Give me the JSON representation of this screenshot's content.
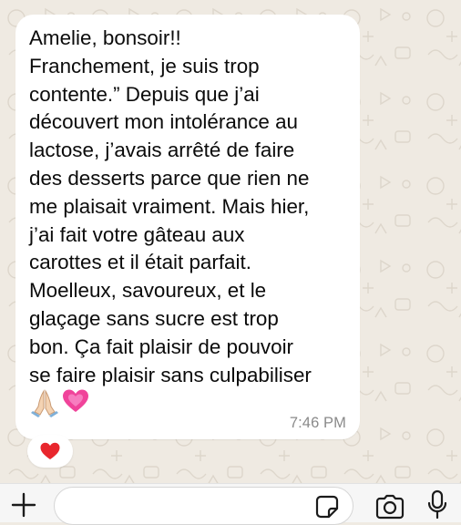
{
  "message": {
    "text": "Amelie, bonsoir!!\nFranchement, je suis trop\ncontente.” Depuis que j’ai\ndécouvert mon intolérance au\nlactose, j’avais arrêté de faire\ndes desserts parce que rien ne\nme plaisait vraiment. Mais hier,\nj’ai fait votre gâteau aux\ncarottes et il était parfait.\nMoelleux, savoureux, et le\nglaçage sans sucre est trop\nbon. Ça fait plaisir de pouvoir\nse faire plaisir sans culpabiliser",
    "emojis": [
      "praying-hands",
      "growing-heart"
    ],
    "time": "7:46 PM",
    "reaction": "red-heart"
  },
  "input": {
    "value": "",
    "placeholder": ""
  },
  "icons": {
    "attach": "plus-icon",
    "sticker": "sticker-icon",
    "camera": "camera-icon",
    "microphone": "microphone-icon"
  },
  "colors": {
    "wallpaper": "#efeae2",
    "bubble": "#ffffff",
    "heart": "#e8262d",
    "growing_heart": "#f0439a",
    "time": "#8a8a8a"
  }
}
